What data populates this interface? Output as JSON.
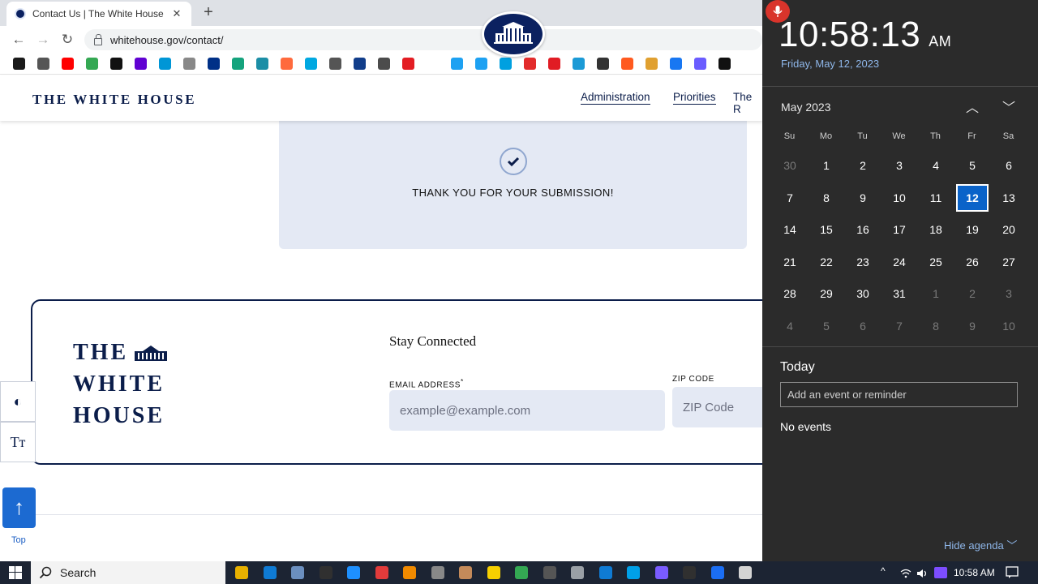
{
  "browser": {
    "tab_title": "Contact Us | The White House",
    "tab_close": "✕",
    "new_tab": "+",
    "url": "whitehouse.gov/contact/",
    "back": "←",
    "forward": "→",
    "reload": "↻"
  },
  "bookmark_colors": [
    "#1a1a1a",
    "#555555",
    "#ff0000",
    "#34a853",
    "#111111",
    "#6001d2",
    "#0096d6",
    "#888888",
    "#003087",
    "#15a37d",
    "#1c8ea6",
    "#ff6a3d",
    "#00a8e1",
    "#555555",
    "#113d8a",
    "#4c4c4c",
    "#e31d23",
    "#ffffff",
    "#1da1f2",
    "#1da1f2",
    "#00a0e0",
    "#e22b2b",
    "#e11c24",
    "#1b9ad6",
    "#333333",
    "#ff5a1f",
    "#e0a030",
    "#1877f2",
    "#6a5cff",
    "#111111"
  ],
  "site": {
    "logo": "THE WHITE HOUSE",
    "nav": [
      "Administration",
      "Priorities",
      "The R"
    ],
    "thank_you": "THANK YOU FOR YOUR SUBMISSION!",
    "brand_lines": [
      "THE",
      "WHITE",
      "HOUSE"
    ],
    "stay_connected": "Stay Connected",
    "email_label": "EMAIL ADDRESS",
    "email_required": "*",
    "email_placeholder": "example@example.com",
    "zip_label": "ZIP CODE",
    "zip_placeholder": "ZIP Code",
    "contrast_icon": "◐",
    "text_size_icon": "Tт",
    "top_label": "Top",
    "top_arrow": "↑"
  },
  "calendar": {
    "time": "10:58:13",
    "ampm": "AM",
    "date": "Friday, May 12, 2023",
    "month": "May 2023",
    "prev": "︿",
    "next": "﹀",
    "weekdays": [
      "Su",
      "Mo",
      "Tu",
      "We",
      "Th",
      "Fr",
      "Sa"
    ],
    "weeks": [
      [
        "30",
        "1",
        "2",
        "3",
        "4",
        "5",
        "6"
      ],
      [
        "7",
        "8",
        "9",
        "10",
        "11",
        "12",
        "13"
      ],
      [
        "14",
        "15",
        "16",
        "17",
        "18",
        "19",
        "20"
      ],
      [
        "21",
        "22",
        "23",
        "24",
        "25",
        "26",
        "27"
      ],
      [
        "28",
        "29",
        "30",
        "31",
        "1",
        "2",
        "3"
      ],
      [
        "4",
        "5",
        "6",
        "7",
        "8",
        "9",
        "10"
      ]
    ],
    "selected": "12",
    "today_label": "Today",
    "event_placeholder": "Add an event or reminder",
    "no_events": "No events",
    "hide_agenda": "Hide agenda",
    "hide_agenda_chevron": "﹀"
  },
  "taskbar": {
    "search": "Search",
    "clock": "10:58 AM",
    "pinned_colors": [
      "#e8b100",
      "#0f7bd4",
      "#6b8fbf",
      "#303030",
      "#1e90ff",
      "#e23b3b",
      "#f08a00",
      "#888888",
      "#c48a5a",
      "#f7d000",
      "#34a853",
      "#555555",
      "#9aa0a6",
      "#0f7bd4",
      "#00a0e8",
      "#7a5cff",
      "#303030",
      "#1b6ef3",
      "#d4d4d4"
    ],
    "up_caret": "^"
  }
}
